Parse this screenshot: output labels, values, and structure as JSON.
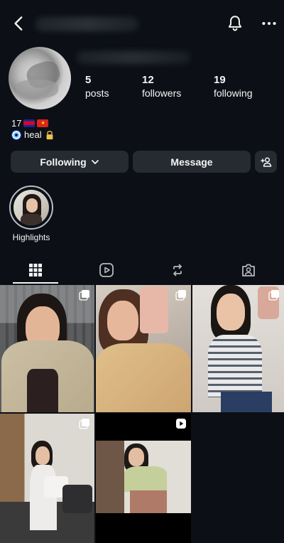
{
  "profile": {
    "posts_count": "5",
    "posts_label": "posts",
    "followers_count": "12",
    "followers_label": "followers",
    "following_count": "19",
    "following_label": "following",
    "bio_line1_text": "17",
    "bio_line2_text": "heal"
  },
  "actions": {
    "following_label": "Following",
    "message_label": "Message"
  },
  "highlights": [
    {
      "label": "Highlights"
    }
  ],
  "tabs": [
    {
      "name": "grid",
      "icon": "grid-icon",
      "active": true
    },
    {
      "name": "reels",
      "icon": "reels-icon",
      "active": false
    },
    {
      "name": "reposts",
      "icon": "repost-icon",
      "active": false
    },
    {
      "name": "tagged",
      "icon": "tagged-icon",
      "active": false
    }
  ],
  "posts": [
    {
      "type": "carousel",
      "icon": "carousel-icon"
    },
    {
      "type": "carousel",
      "icon": "carousel-icon"
    },
    {
      "type": "carousel",
      "icon": "carousel-icon"
    },
    {
      "type": "carousel",
      "icon": "carousel-icon"
    },
    {
      "type": "reel",
      "icon": "reel-icon"
    }
  ],
  "colors": {
    "background": "#0c1016",
    "button": "#262a31",
    "text": "#f5f5f5"
  }
}
